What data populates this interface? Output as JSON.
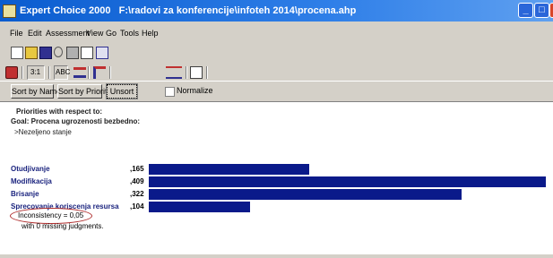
{
  "window": {
    "app_name": "Expert Choice 2000",
    "file_path": "F:\\radovi za konferencije\\infoteh 2014\\procena.ahp"
  },
  "menu": [
    "File",
    "Edit",
    "Assessment",
    "View",
    "Go",
    "Tools",
    "Help"
  ],
  "toolbar2": {
    "group1_text": "3:1",
    "group2_text": "ABC"
  },
  "sortbar": {
    "sort_by_name": "Sort by Name",
    "sort_by_priority": "Sort by Priority",
    "unsort": "Unsort",
    "normalize": "Normalize"
  },
  "report": {
    "title": "Priorities with respect to:",
    "goal": "Goal: Procena ugrozenosti bezbedno:",
    "node": ">Nezeljeno stanje",
    "rows": [
      {
        "label": "Otudjivanje",
        "value": ",165",
        "priority": 0.165
      },
      {
        "label": "Modifikacija",
        "value": ",409",
        "priority": 0.409
      },
      {
        "label": "Brisanje",
        "value": ",322",
        "priority": 0.322
      },
      {
        "label": "Sprecovanje koriscenja resursa",
        "value": ",104",
        "priority": 0.104
      }
    ],
    "inconsistency": "Inconsistency = 0,05",
    "missing": "with 0  missing judgments."
  },
  "colors": {
    "bar": "#0a1a8a",
    "label": "#1a237e",
    "titlebar": "#0a5ccf"
  }
}
